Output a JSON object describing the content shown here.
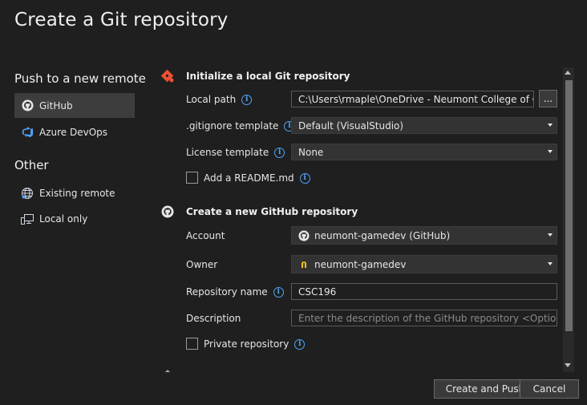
{
  "dialog": {
    "title": "Create a Git repository"
  },
  "sidebar": {
    "push_heading": "Push to a new remote",
    "push_items": [
      {
        "label": "GitHub",
        "icon": "github-icon",
        "selected": true
      },
      {
        "label": "Azure DevOps",
        "icon": "azure-devops-icon",
        "selected": false
      }
    ],
    "other_heading": "Other",
    "other_items": [
      {
        "label": "Existing remote",
        "icon": "globe-icon"
      },
      {
        "label": "Local only",
        "icon": "computer-icon"
      }
    ]
  },
  "local_repo": {
    "title": "Initialize a local Git repository",
    "local_path_label": "Local path",
    "local_path_value": "C:\\Users\\rmaple\\OneDrive - Neumont College of Comp",
    "browse_label": "...",
    "gitignore_label": ".gitignore template",
    "gitignore_value": "Default (VisualStudio)",
    "license_label": "License template",
    "license_value": "None",
    "readme_label": "Add a README.md",
    "readme_checked": false
  },
  "github_repo": {
    "title": "Create a new GitHub repository",
    "account_label": "Account",
    "account_value": "neumont-gamedev (GitHub)",
    "owner_label": "Owner",
    "owner_value": "neumont-gamedev",
    "repo_name_label": "Repository name",
    "repo_name_value": "CSC196",
    "description_label": "Description",
    "description_placeholder": "Enter the description of the GitHub repository <Optional>",
    "private_label": "Private repository",
    "private_checked": false
  },
  "footer": {
    "create_label": "Create and Push",
    "cancel_label": "Cancel"
  },
  "colors": {
    "background": "#1f1f1f",
    "accent_info": "#4fa3f7",
    "git_icon": "#f05033",
    "owner_icon": "#f5c518"
  }
}
